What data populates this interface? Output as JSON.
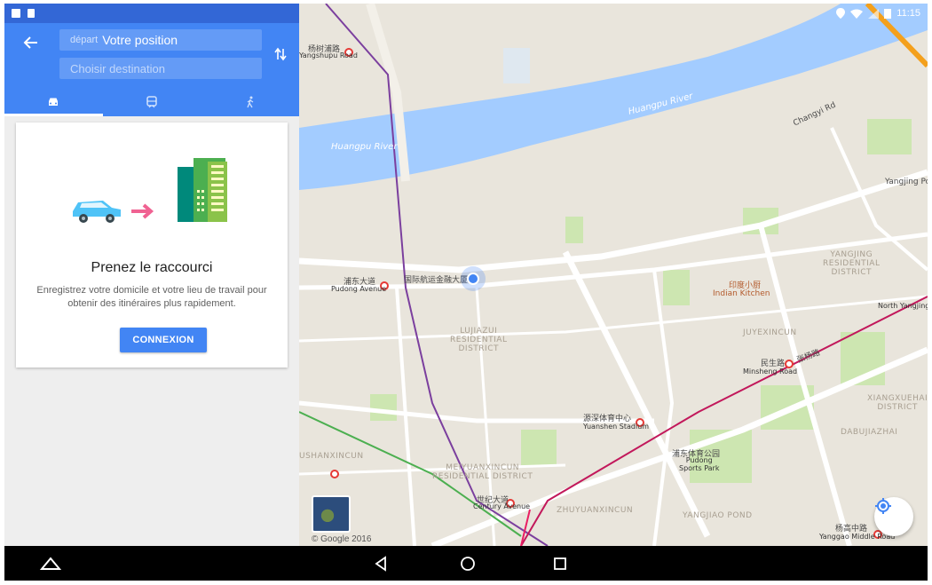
{
  "status_bar": {
    "time": "11:15"
  },
  "directions": {
    "origin_prefix": "départ",
    "origin_value": "Votre position",
    "destination_placeholder": "Choisir destination",
    "tabs": [
      {
        "mode": "driving",
        "icon": "car-icon",
        "active": true
      },
      {
        "mode": "transit",
        "icon": "train-icon",
        "active": false
      },
      {
        "mode": "walking",
        "icon": "walk-icon",
        "active": false
      }
    ]
  },
  "shortcut_card": {
    "title": "Prenez le raccourci",
    "description": "Enregistrez votre domicile et votre lieu de travail pour obtenir des itinéraires plus rapidement.",
    "button_label": "CONNEXION"
  },
  "map": {
    "copyright": "© Google 2016",
    "labels": {
      "huangpu_river_1": "Huangpu River",
      "huangpu_river_2": "Huangpu River",
      "yangjing": "YANGJING\nRESIDENTIAL\nDISTRICT",
      "lujiazui": "LUJIAZUI\nRESIDENTIAL\nDISTRICT",
      "juyexincun": "JUYEXINCUN",
      "ushanxincun": "USHANXINCUN",
      "meiyuanxincun": "MEIYUANXINCUN\nRESIDENTIAL DISTRICT",
      "zhuyuanxincun": "ZHUYUANXINCUN",
      "yangjiao_pond": "YANGJIAO POND",
      "xiangxuehai": "XIANGXUEHAI\nDISTRICT",
      "dabujiazhai": "DABUJIAZHAI",
      "indian_kitchen": "Indian Kitchen",
      "pudong_sports_park": "Pudong\nSports Park",
      "yanging_port": "Yangjing Port",
      "north_yanging": "North Yangjing Road",
      "minsheng_road": "Minsheng Road",
      "pudong_avenue": "Pudong Avenue",
      "yuanshen_stadium": "Yuanshen Stadium",
      "century_avenue": "Century Avenue",
      "yanggao_middle": "Yanggao Middle Road",
      "yangshupu_road": "Yangshupu Road",
      "changyi_rd": "Changyi Rd",
      "guoji_hangyun": "国际航运金融大厦",
      "pudong_dadao": "浦东大道",
      "yangshupu_cn": "杨树浦路",
      "minsheng_cn": "民生路",
      "shiji_dadao": "世纪大道",
      "yuanshen_cn": "源深体育中心",
      "yanggao_cn": "杨高中路",
      "pudong_tiyu": "浦东体育公园",
      "yindu_xiaochu": "印度小厨",
      "zhangyang_lu": "张杨路"
    }
  },
  "nav": {
    "home": "home-button",
    "back": "back-button",
    "home_circle": "home-circle-button",
    "recents": "recents-button"
  }
}
